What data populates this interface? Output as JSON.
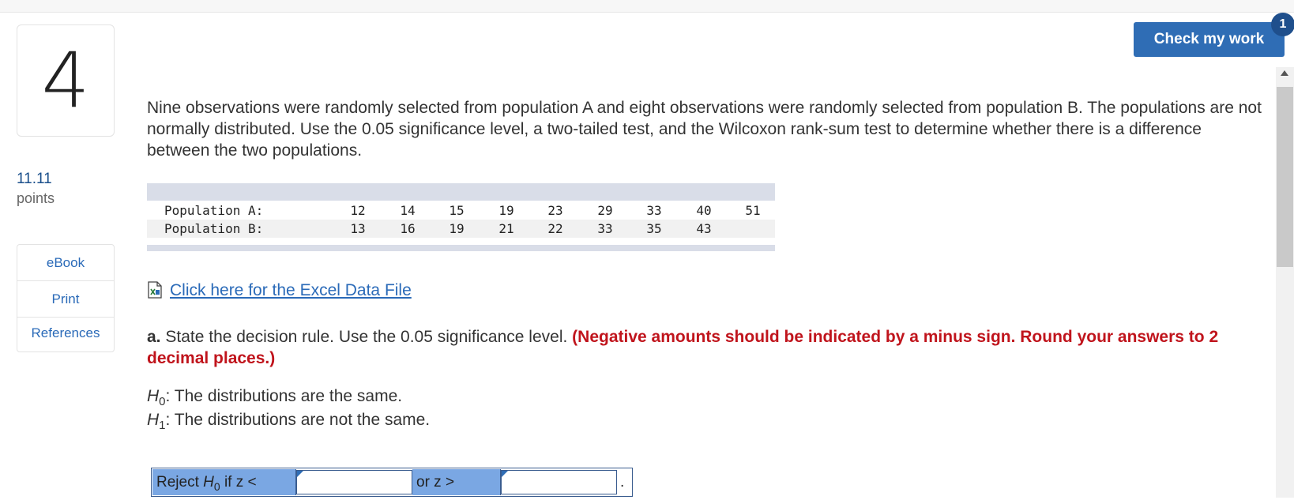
{
  "question": {
    "number": "4",
    "points_value": "11.11",
    "points_label": "points",
    "text": "Nine observations were randomly selected from population A and eight observations were randomly selected from population B. The populations are not normally distributed. Use the 0.05 significance level, a two-tailed test, and the Wilcoxon rank-sum test to determine whether there is a difference between the two populations."
  },
  "sidebar": {
    "links": [
      {
        "label": "eBook"
      },
      {
        "label": "Print"
      },
      {
        "label": "References"
      }
    ]
  },
  "header": {
    "check_label": "Check my work",
    "badge": "1"
  },
  "data_table": {
    "rows": [
      {
        "label": "Population A:",
        "values": [
          "12",
          "14",
          "15",
          "19",
          "23",
          "29",
          "33",
          "40",
          "51"
        ]
      },
      {
        "label": "Population B:",
        "values": [
          "13",
          "16",
          "19",
          "21",
          "22",
          "33",
          "35",
          "43"
        ]
      }
    ]
  },
  "excel_link": "Click here for the Excel Data File",
  "part_a": {
    "label": "a.",
    "text": "State the decision rule. Use the 0.05 significance level.",
    "instruction": "(Negative amounts should be indicated by a minus sign. Round your answers to 2 decimal places.)"
  },
  "hypotheses": {
    "h0_symbol": "H",
    "h0_sub": "0",
    "h0_text": ": The distributions are the same.",
    "h1_symbol": "H",
    "h1_sub": "1",
    "h1_text": ": The distributions are not the same."
  },
  "decision_rule": {
    "reject_prefix": "Reject",
    "reject_symbol": "H",
    "reject_sub": "0",
    "reject_suffix": "if z <",
    "or_label": "or z >",
    "input1_value": "",
    "input2_value": "",
    "end_punct": "."
  },
  "colors": {
    "accent": "#2f6db5",
    "instruction_red": "#c0141c",
    "rule_cell_blue": "#7aa7e3"
  }
}
